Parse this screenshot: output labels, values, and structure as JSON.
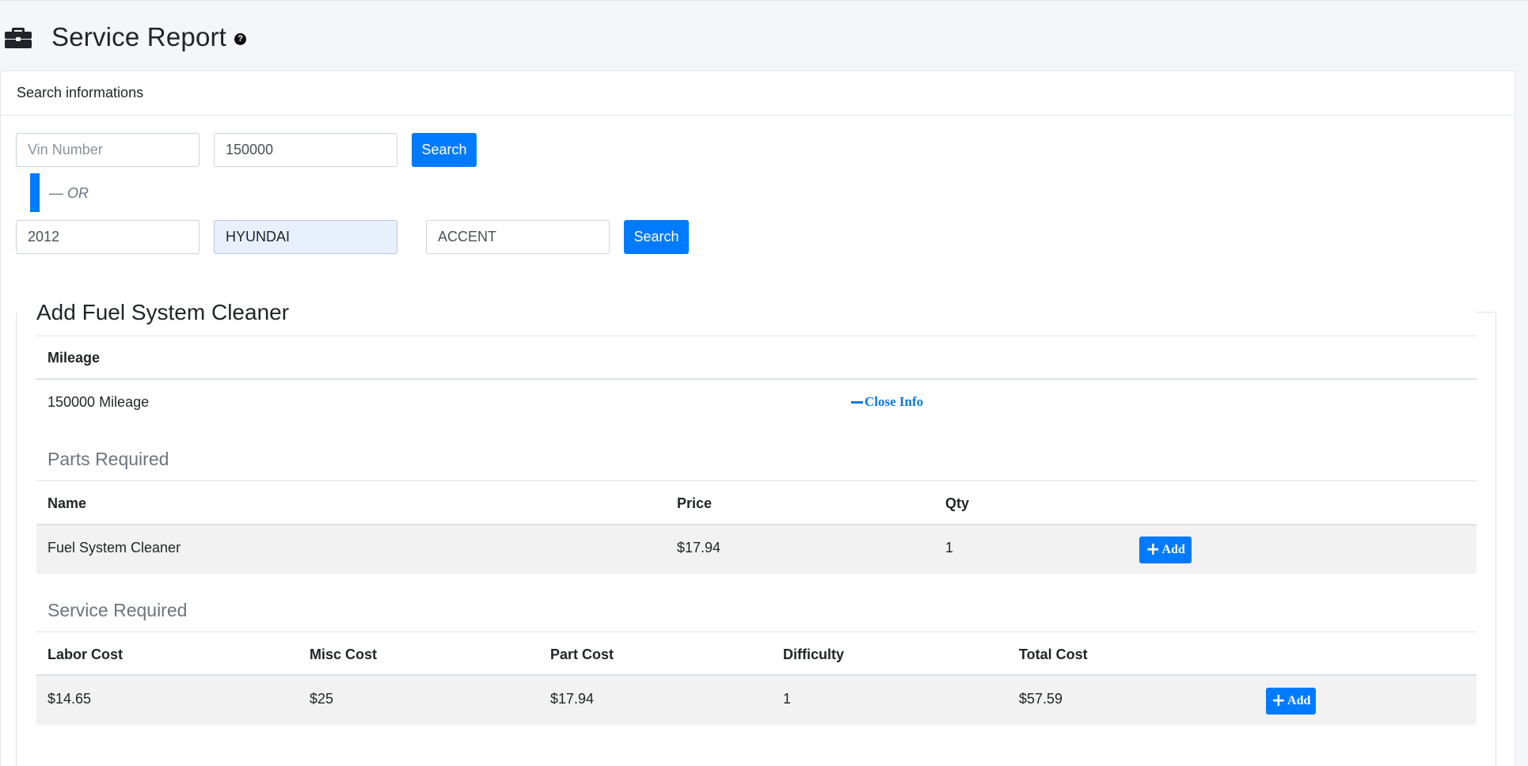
{
  "header": {
    "title": "Service Report",
    "help_icon": "?"
  },
  "search": {
    "card_title": "Search informations",
    "vin_placeholder": "Vin Number",
    "mileage_value": "150000",
    "search_label": "Search",
    "or_label": "— OR",
    "year_value": "2012",
    "make_value": "HYUNDAI",
    "model_value": "ACCENT",
    "search2_label": "Search"
  },
  "service": {
    "legend": "Add Fuel System Cleaner",
    "mileage_header": "Mileage",
    "mileage_value": "150000 Mileage",
    "close_info_label": "Close Info",
    "parts_title": "Parts Required",
    "parts_columns": [
      "Name",
      "Price",
      "Qty"
    ],
    "parts_rows": [
      {
        "name": "Fuel System Cleaner",
        "price": "$17.94",
        "qty": "1",
        "add_label": "Add"
      }
    ],
    "service_title": "Service Required",
    "service_columns": [
      "Labor Cost",
      "Misc Cost",
      "Part Cost",
      "Difficulty",
      "Total Cost"
    ],
    "service_rows": [
      {
        "labor": "$14.65",
        "misc": "$25",
        "part": "$17.94",
        "difficulty": "1",
        "total": "$57.59",
        "add_label": "Add"
      }
    ]
  },
  "colors": {
    "accent": "#007bff",
    "page_bg": "#f4f6f9",
    "row_bg": "#f2f2f2"
  }
}
